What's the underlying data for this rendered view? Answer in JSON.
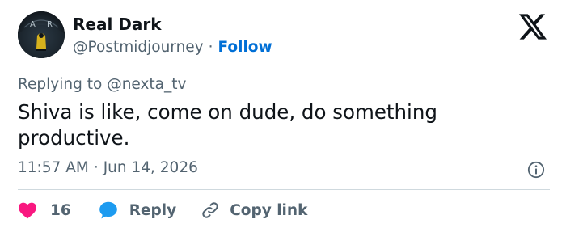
{
  "tweet": {
    "author_name": "Real Dark",
    "author_handle": "@Postmidjourney",
    "separator": "·",
    "follow_label": "Follow",
    "replying_prefix": "Replying to",
    "replying_handle": "@nexta_tv",
    "text": "Shiva is like, come on dude, do something productive.",
    "time": "11:57 AM",
    "date": "Jun 14, 2026",
    "avatar_letters": [
      "A",
      "R"
    ]
  },
  "actions": {
    "like_count": "16",
    "reply_label": "Reply",
    "copy_link_label": "Copy link"
  },
  "colors": {
    "like": "#f91880",
    "reply": "#1d9bf0",
    "follow": "#006fd6",
    "secondary_text": "#536471"
  },
  "icons": {
    "brand": "x-logo-icon",
    "info": "info-icon",
    "like": "heart-icon",
    "reply": "speech-bubble-icon",
    "copy": "link-icon"
  }
}
